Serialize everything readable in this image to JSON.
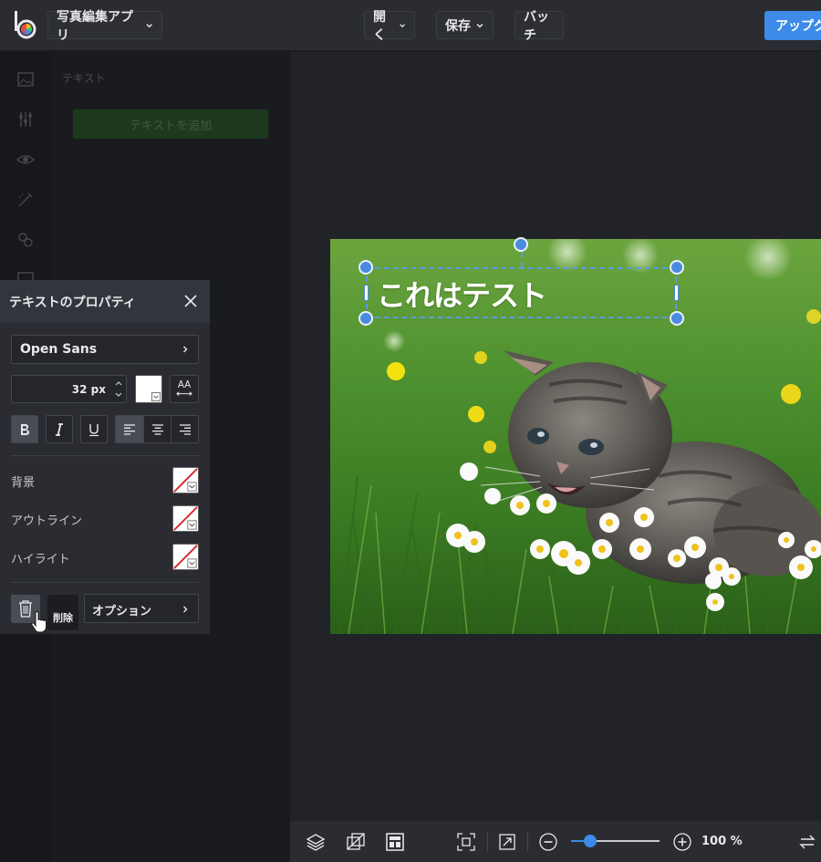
{
  "app": {
    "name": "写真編集アプリ",
    "menu": {
      "open": "開く",
      "save": "保存",
      "batch": "バッチ"
    },
    "upgrade": "アップグレード"
  },
  "sidebar": {
    "panel_title": "テキスト",
    "add_text": "テキストを追加"
  },
  "canvas": {
    "text_layer": "これはテスト"
  },
  "props": {
    "title": "テキストのプロパティ",
    "font": "Open Sans",
    "size": "32 px",
    "case_icon_label": "AA",
    "rows": {
      "background": "背景",
      "outline": "アウトライン",
      "highlight": "ハイライト"
    },
    "delete_tooltip": "削除",
    "options": "オプション"
  },
  "bottombar": {
    "zoom": "100 %",
    "zoom_fraction": 0.22
  },
  "colors": {
    "accent": "#3d8ae8",
    "text_color": "#ffffff"
  }
}
